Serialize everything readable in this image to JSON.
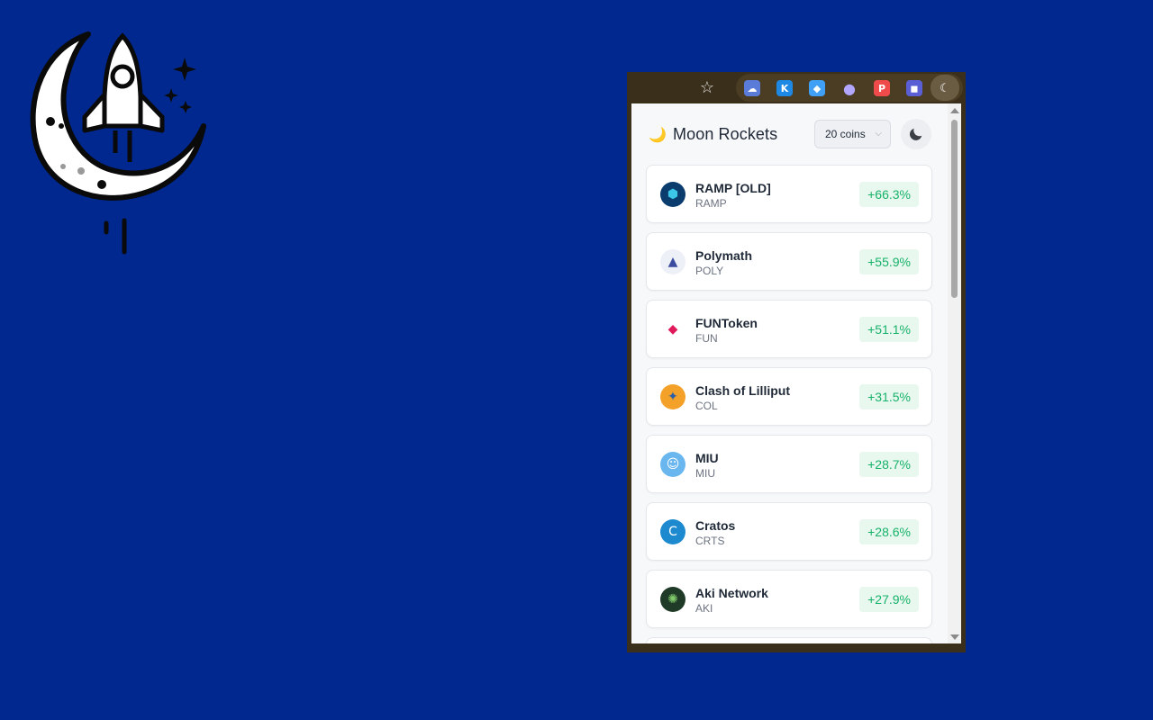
{
  "toolbar": {
    "bookmark_icon": "star-icon",
    "extensions": [
      {
        "name": "ext-cloud-icon",
        "glyph": "☁",
        "color": "#5a7bd8"
      },
      {
        "name": "ext-k-icon",
        "glyph": "K",
        "color": "#1e88e5"
      },
      {
        "name": "ext-drop-icon",
        "glyph": "◆",
        "color": "#3fa0f5"
      },
      {
        "name": "ext-ghost-icon",
        "glyph": "●",
        "color": "#9a8cf0"
      },
      {
        "name": "ext-p-icon",
        "glyph": "P",
        "color": "#ef4b4b"
      },
      {
        "name": "ext-shield-icon",
        "glyph": "◼",
        "color": "#5a5fd6"
      }
    ],
    "active_extension": "moon-rockets-icon"
  },
  "header": {
    "brand_icon": "🌙",
    "title": "Moon Rockets",
    "coins_select": "20 coins",
    "theme_toggle_icon": "moon-icon"
  },
  "coins": [
    {
      "name": "RAMP [OLD]",
      "symbol": "RAMP",
      "change": "+66.3%",
      "logo_bg": "#0a3c6e",
      "logo_fg": "#3cc6e8",
      "logo_glyph": "⬢"
    },
    {
      "name": "Polymath",
      "symbol": "POLY",
      "change": "+55.9%",
      "logo_bg": "#eef0f8",
      "logo_fg": "#3b4ba0",
      "logo_glyph": "▲"
    },
    {
      "name": "FUNToken",
      "symbol": "FUN",
      "change": "+51.1%",
      "logo_bg": "#ffffff",
      "logo_fg": "#e0195a",
      "logo_glyph": "◆"
    },
    {
      "name": "Clash of Lilliput",
      "symbol": "COL",
      "change": "+31.5%",
      "logo_bg": "#f4a12a",
      "logo_fg": "#2a5ea8",
      "logo_glyph": "✦"
    },
    {
      "name": "MIU",
      "symbol": "MIU",
      "change": "+28.7%",
      "logo_bg": "#6ab6ee",
      "logo_fg": "#ffffff",
      "logo_glyph": "☺"
    },
    {
      "name": "Cratos",
      "symbol": "CRTS",
      "change": "+28.6%",
      "logo_bg": "#1d8ad0",
      "logo_fg": "#ffffff",
      "logo_glyph": "C"
    },
    {
      "name": "Aki Network",
      "symbol": "AKI",
      "change": "+27.9%",
      "logo_bg": "#1f3b27",
      "logo_fg": "#7fc96a",
      "logo_glyph": "✺"
    }
  ]
}
